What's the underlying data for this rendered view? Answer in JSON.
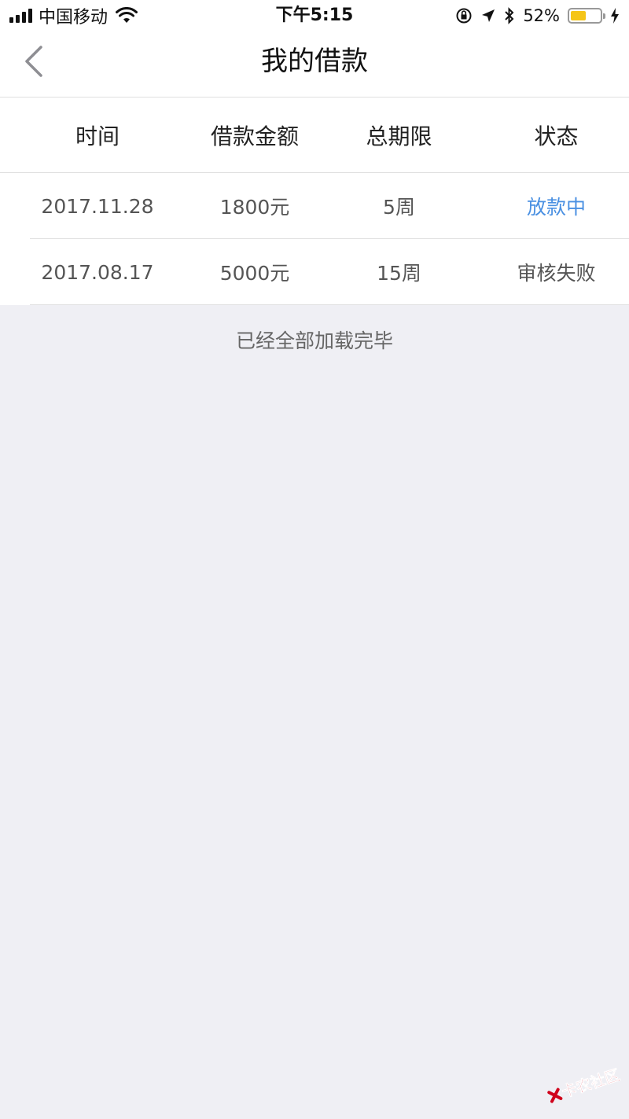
{
  "status_bar": {
    "carrier": "中国移动",
    "time": "下午5:15",
    "battery_percent": "52%",
    "battery_level": 0.52
  },
  "nav": {
    "title": "我的借款"
  },
  "table": {
    "columns": [
      "时间",
      "借款金额",
      "总期限",
      "状态"
    ],
    "rows": [
      {
        "date": "2017.11.28",
        "amount": "1800元",
        "term": "5周",
        "status": "放款中"
      },
      {
        "date": "2017.08.17",
        "amount": "5000元",
        "term": "15周",
        "status": "审核失败"
      }
    ]
  },
  "footer": {
    "load_complete": "已经全部加载完毕"
  },
  "watermark": {
    "text": "卡农社区"
  },
  "colors": {
    "accent": "#4a90e2",
    "background": "#efeff4",
    "battery": "#f5c518"
  }
}
